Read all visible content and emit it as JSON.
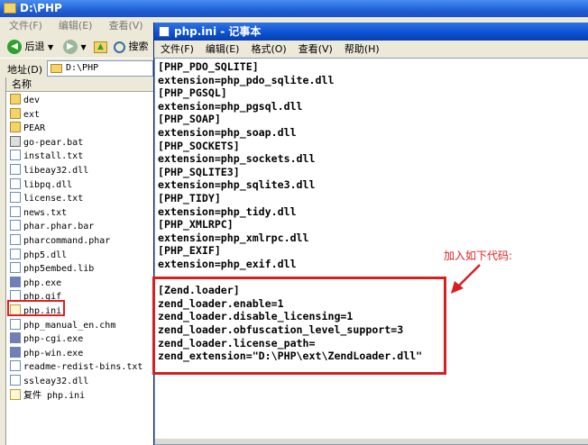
{
  "explorer": {
    "title": "D:\\PHP",
    "menu": [
      "文件(F)",
      "编辑(E)",
      "查看(V)"
    ],
    "toolbar": {
      "back_label": "后退",
      "search_label": "搜索"
    },
    "address": {
      "label": "地址(D)",
      "value": "D:\\PHP"
    },
    "column_header": "名称",
    "files": [
      {
        "name": "dev",
        "icon": "folder-icon"
      },
      {
        "name": "ext",
        "icon": "folder-icon"
      },
      {
        "name": "PEAR",
        "icon": "folder-icon"
      },
      {
        "name": "go-pear.bat",
        "icon": "batch-file-icon"
      },
      {
        "name": "install.txt",
        "icon": "text-file-icon"
      },
      {
        "name": "libeay32.dll",
        "icon": "dll-file-icon"
      },
      {
        "name": "libpq.dll",
        "icon": "dll-file-icon"
      },
      {
        "name": "license.txt",
        "icon": "text-file-icon"
      },
      {
        "name": "news.txt",
        "icon": "text-file-icon"
      },
      {
        "name": "phar.phar.bar",
        "icon": "file-icon"
      },
      {
        "name": "pharcommand.phar",
        "icon": "file-icon"
      },
      {
        "name": "php5.dll",
        "icon": "dll-file-icon"
      },
      {
        "name": "php5embed.lib",
        "icon": "file-icon"
      },
      {
        "name": "php.exe",
        "icon": "php-exe-icon"
      },
      {
        "name": "php.gif",
        "icon": "image-file-icon"
      },
      {
        "name": "php.ini",
        "icon": "ini-file-icon"
      },
      {
        "name": "php_manual_en.chm",
        "icon": "help-file-icon"
      },
      {
        "name": "php-cgi.exe",
        "icon": "php-exe-icon"
      },
      {
        "name": "php-win.exe",
        "icon": "php-exe-icon"
      },
      {
        "name": "readme-redist-bins.txt",
        "icon": "text-file-icon"
      },
      {
        "name": "ssleay32.dll",
        "icon": "dll-file-icon"
      },
      {
        "name": "复件 php.ini",
        "icon": "ini-file-icon"
      }
    ]
  },
  "notepad": {
    "title": "php.ini - 记事本",
    "menu": [
      "文件(F)",
      "编辑(E)",
      "格式(O)",
      "查看(V)",
      "帮助(H)"
    ],
    "lines": [
      "[PHP_PDO_SQLITE]",
      "extension=php_pdo_sqlite.dll",
      "[PHP_PGSQL]",
      "extension=php_pgsql.dll",
      "[PHP_SOAP]",
      "extension=php_soap.dll",
      "[PHP_SOCKETS]",
      "extension=php_sockets.dll",
      "[PHP_SQLITE3]",
      "extension=php_sqlite3.dll",
      "[PHP_TIDY]",
      "extension=php_tidy.dll",
      "[PHP_XMLRPC]",
      "extension=php_xmlrpc.dll",
      "[PHP_EXIF]",
      "extension=php_exif.dll",
      "",
      "[Zend.loader]",
      "zend_loader.enable=1",
      "zend_loader.disable_licensing=1",
      "zend_loader.obfuscation_level_support=3",
      "zend_loader.license_path=",
      "zend_extension=\"D:\\PHP\\ext\\ZendLoader.dll\""
    ]
  },
  "annotation": {
    "text": "加入如下代码:",
    "color": "#e02020"
  }
}
